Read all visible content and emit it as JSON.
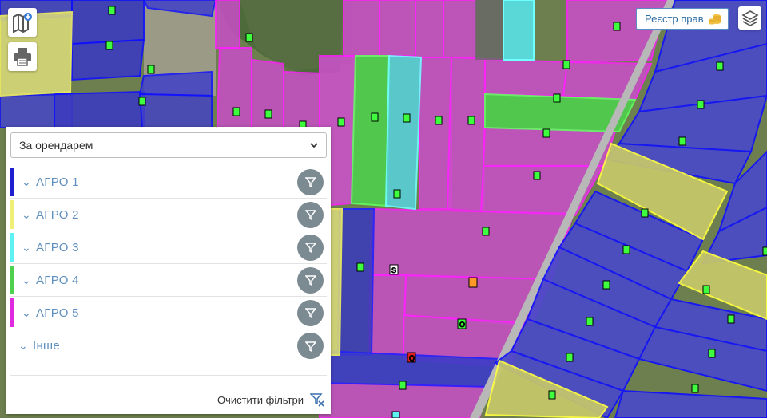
{
  "toolbar": {
    "map_add_icon": "map-plus-icon",
    "print_icon": "printer-icon",
    "registry_label": "Реєстр прав",
    "registry_icon": "coins-icon",
    "layers_icon": "layers-icon"
  },
  "filter_panel": {
    "group_by": {
      "selected": "За орендарем"
    },
    "groups": [
      {
        "label": "АГРО 1",
        "color": "#1f1fd0"
      },
      {
        "label": "АГРО 2",
        "color": "#f0f078"
      },
      {
        "label": "АГРО 3",
        "color": "#5ef2f2"
      },
      {
        "label": "АГРО 4",
        "color": "#4fd14f"
      },
      {
        "label": "АГРО 5",
        "color": "#e02ae0"
      },
      {
        "label": "Інше",
        "color": ""
      }
    ],
    "clear_label": "Очистити фільтри"
  },
  "map": {
    "markers": [
      "S",
      "O",
      "Q"
    ]
  }
}
